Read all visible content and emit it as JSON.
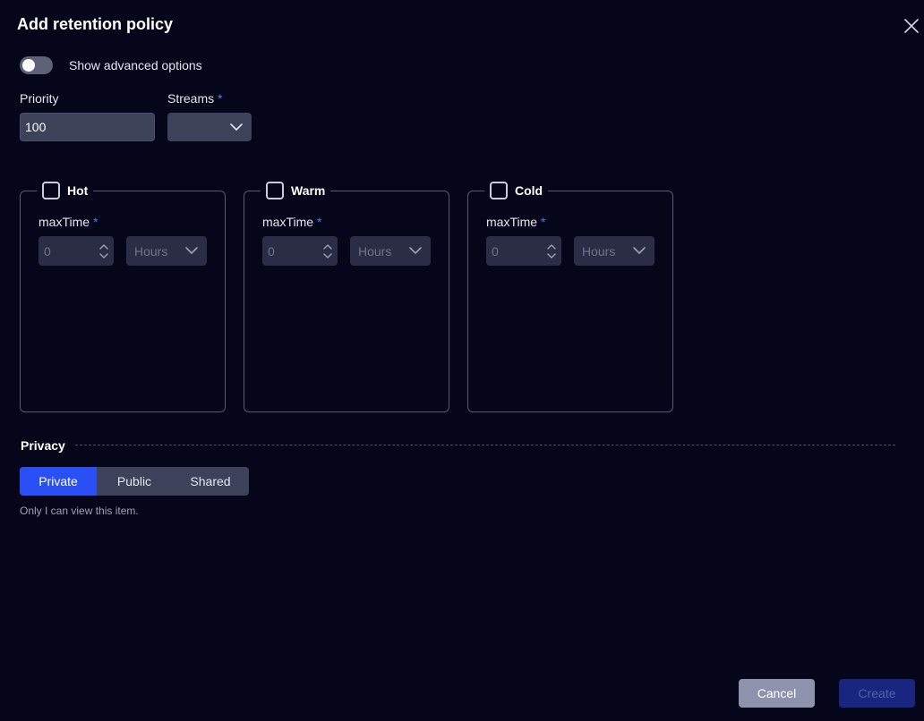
{
  "dialog": {
    "title": "Add retention policy"
  },
  "advanced_toggle": {
    "label": "Show advanced options",
    "enabled": false
  },
  "priority": {
    "label": "Priority",
    "value": "100"
  },
  "streams": {
    "label": "Streams",
    "required_mark": "*",
    "value": ""
  },
  "tiers": [
    {
      "name": "Hot",
      "field_label": "maxTime",
      "required_mark": "*",
      "value": "0",
      "unit": "Hours",
      "checked": false
    },
    {
      "name": "Warm",
      "field_label": "maxTime",
      "required_mark": "*",
      "value": "0",
      "unit": "Hours",
      "checked": false
    },
    {
      "name": "Cold",
      "field_label": "maxTime",
      "required_mark": "*",
      "value": "0",
      "unit": "Hours",
      "checked": false
    }
  ],
  "privacy": {
    "label": "Privacy",
    "options": [
      "Private",
      "Public",
      "Shared"
    ],
    "selected": "Private",
    "help": "Only I can view this item."
  },
  "footer": {
    "cancel_label": "Cancel",
    "create_label": "Create"
  },
  "colors": {
    "background": "#06061a",
    "accent": "#2a50f5",
    "required": "#3b82f6",
    "create_disabled": "#192680"
  },
  "icons": {
    "close": "close-icon",
    "dropdown": "chevron-down-icon",
    "stepper": "stepper-icon"
  }
}
